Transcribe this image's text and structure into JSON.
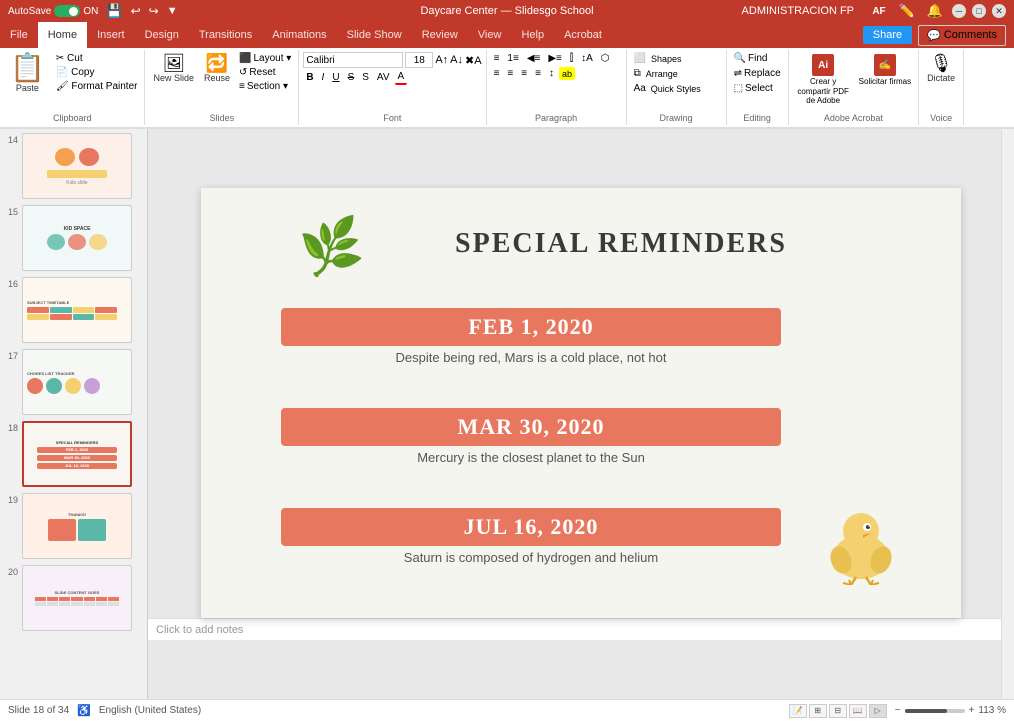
{
  "app": {
    "title": "Daycare Center — Slidesgo School",
    "autosave_label": "AutoSave",
    "autosave_on": "ON"
  },
  "title_bar": {
    "title": "Daycare Center — Slidesgo School",
    "admin_label": "ADMINISTRACION FP",
    "user_initials": "AF",
    "min_btn": "─",
    "max_btn": "□",
    "close_btn": "✕"
  },
  "tabs": [
    {
      "label": "File",
      "active": false
    },
    {
      "label": "Home",
      "active": true
    },
    {
      "label": "Insert",
      "active": false
    },
    {
      "label": "Design",
      "active": false
    },
    {
      "label": "Transitions",
      "active": false
    },
    {
      "label": "Animations",
      "active": false
    },
    {
      "label": "Slide Show",
      "active": false
    },
    {
      "label": "Review",
      "active": false
    },
    {
      "label": "View",
      "active": false
    },
    {
      "label": "Help",
      "active": false
    },
    {
      "label": "Acrobat",
      "active": false
    }
  ],
  "ribbon": {
    "clipboard_label": "Clipboard",
    "slides_label": "Slides",
    "font_label": "Font",
    "paragraph_label": "Paragraph",
    "drawing_label": "Drawing",
    "editing_label": "Editing",
    "adobe_label": "Adobe Acrobat",
    "voice_label": "Voice",
    "paste_label": "Paste",
    "new_slide_label": "New Slide",
    "reuse_label": "Reuse",
    "layout_label": "Layout",
    "reset_label": "Reset",
    "section_label": "Section",
    "find_label": "Find",
    "replace_label": "Replace",
    "select_label": "Select",
    "shapes_label": "Shapes",
    "arrange_label": "Arrange",
    "quick_styles_label": "Quick Styles",
    "dictate_label": "Dictate",
    "share_label": "Share",
    "comments_label": "Comments",
    "font_name": "Calibri",
    "font_size": "18",
    "adobe_create_label": "Crear y compartir PDF de Adobe",
    "adobe_request_label": "Solicitar firmas"
  },
  "slides": [
    {
      "num": "14",
      "type": "kids"
    },
    {
      "num": "15",
      "type": "bubbles"
    },
    {
      "num": "16",
      "type": "reminders_mini"
    },
    {
      "num": "17",
      "type": "checklist"
    },
    {
      "num": "18",
      "type": "special_reminders",
      "active": true
    },
    {
      "num": "19",
      "type": "toys"
    },
    {
      "num": "20",
      "type": "calendar"
    }
  ],
  "main_slide": {
    "title": "SPECIAL REMINDERS",
    "date1": "FEB 1, 2020",
    "desc1": "Despite being red, Mars is a cold place, not hot",
    "date2": "MAR 30, 2020",
    "desc2": "Mercury is the closest planet to the Sun",
    "date3": "JUL 16, 2020",
    "desc3": "Saturn is composed of hydrogen and helium"
  },
  "status_bar": {
    "slide_count": "Slide 18 of 34",
    "language": "English (United States)",
    "notes_label": "Click to add notes",
    "zoom": "113 %"
  }
}
